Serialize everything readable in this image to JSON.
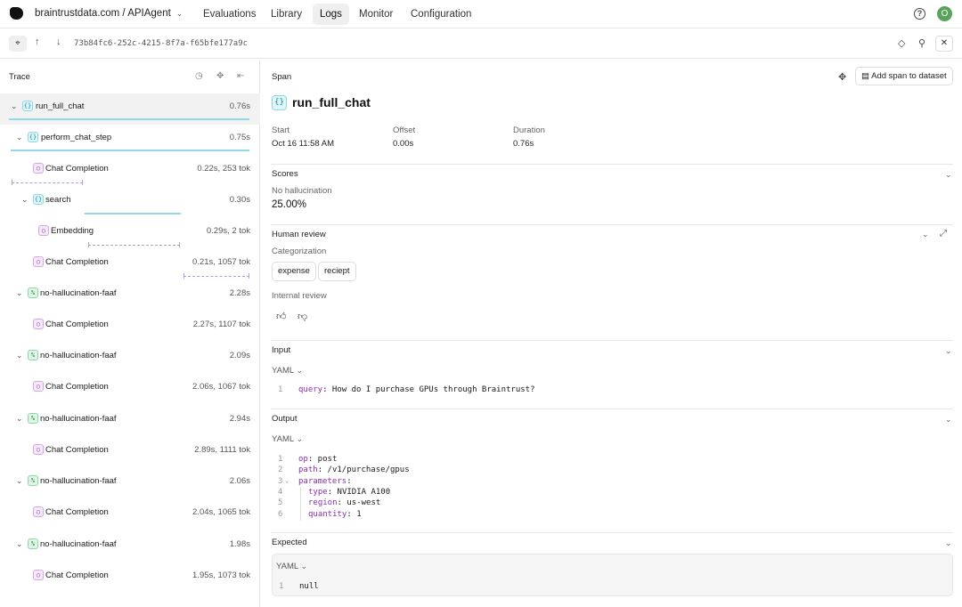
{
  "topnav": {
    "project": "braintrustdata.com / APIAgent",
    "tabs": [
      {
        "label": "Evaluations"
      },
      {
        "label": "Library"
      },
      {
        "label": "Logs"
      },
      {
        "label": "Monitor"
      },
      {
        "label": "Configuration"
      }
    ],
    "active_tab": "Logs",
    "avatar_initial": "O"
  },
  "subbar": {
    "span_id": "73b84fc6-252c-4215-8f7a-f65bfe177a9c"
  },
  "trace": {
    "title": "Trace",
    "rows": [
      {
        "label": "run_full_chat",
        "duration": "0.76s"
      },
      {
        "label": "perform_chat_step",
        "duration": "0.75s"
      },
      {
        "label": "Chat Completion",
        "duration": "0.22s, 253 tok"
      },
      {
        "label": "search",
        "duration": "0.30s"
      },
      {
        "label": "Embedding",
        "duration": "0.29s, 2 tok"
      },
      {
        "label": "Chat Completion",
        "duration": "0.21s, 1057 tok"
      },
      {
        "label": "no-hallucination-faaf",
        "duration": "2.28s"
      },
      {
        "label": "Chat Completion",
        "duration": "2.27s, 1107 tok"
      },
      {
        "label": "no-hallucination-faaf",
        "duration": "2.09s"
      },
      {
        "label": "Chat Completion",
        "duration": "2.06s, 1067 tok"
      },
      {
        "label": "no-hallucination-faaf",
        "duration": "2.94s"
      },
      {
        "label": "Chat Completion",
        "duration": "2.89s, 1111 tok"
      },
      {
        "label": "no-hallucination-faaf",
        "duration": "2.06s"
      },
      {
        "label": "Chat Completion",
        "duration": "2.04s, 1065 tok"
      },
      {
        "label": "no-hallucination-faaf",
        "duration": "1.98s"
      },
      {
        "label": "Chat Completion",
        "duration": "1.95s, 1073 tok"
      }
    ]
  },
  "span": {
    "header": "Span",
    "add_button": "Add span to dataset",
    "title": "run_full_chat",
    "start_label": "Start",
    "start_value": "Oct 16 11:58 AM",
    "offset_label": "Offset",
    "offset_value": "0.00s",
    "duration_label": "Duration",
    "duration_value": "0.76s"
  },
  "scores": {
    "title": "Scores",
    "name": "No hallucination",
    "value": "25.00%"
  },
  "human_review": {
    "title": "Human review",
    "categorization_label": "Categorization",
    "categories": [
      "expense",
      "reciept"
    ],
    "internal_label": "Internal review"
  },
  "input": {
    "title": "Input",
    "format": "YAML",
    "lines": [
      {
        "n": "1",
        "key": "query",
        "val": " How do I purchase GPUs through Braintrust?"
      }
    ]
  },
  "output": {
    "title": "Output",
    "format": "YAML",
    "lines": [
      {
        "n": "1",
        "key": "op",
        "val": " post"
      },
      {
        "n": "2",
        "key": "path",
        "val": " /v1/purchase/gpus"
      },
      {
        "n": "3",
        "key": "parameters",
        "val": ""
      },
      {
        "n": "4",
        "key": "type",
        "val": " NVIDIA A100"
      },
      {
        "n": "5",
        "key": "region",
        "val": " us-west"
      },
      {
        "n": "6",
        "key": "quantity",
        "val": " 1"
      }
    ]
  },
  "expected": {
    "title": "Expected",
    "format": "YAML",
    "line_no": "1",
    "value": "null"
  }
}
